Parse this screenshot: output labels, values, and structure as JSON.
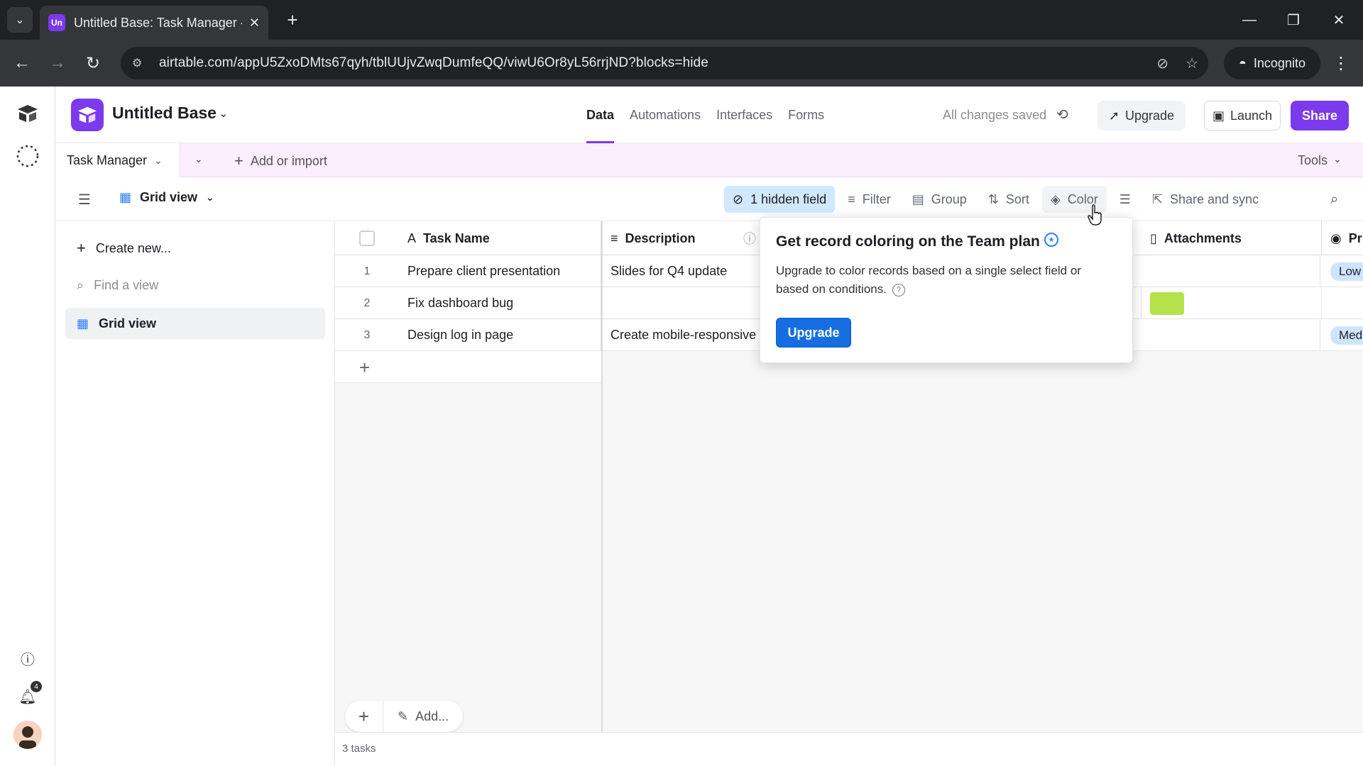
{
  "browser": {
    "tab_title": "Untitled Base: Task Manager - /",
    "tab_favicon_text": "Un",
    "url": "airtable.com/appU5ZxoDMts67qyh/tblUUjvZwqDumfeQQ/viwU6Or8yL56rrjND?blocks=hide",
    "incognito_label": "Incognito"
  },
  "header": {
    "base_name": "Untitled Base",
    "nav": [
      "Data",
      "Automations",
      "Interfaces",
      "Forms"
    ],
    "active_nav": "Data",
    "saved_status": "All changes saved",
    "upgrade_label": "Upgrade",
    "launch_label": "Launch",
    "share_label": "Share",
    "brand_color": "#7c3aed"
  },
  "table_bar": {
    "table_name": "Task Manager",
    "add_import_label": "Add or import",
    "tools_label": "Tools"
  },
  "view_bar": {
    "view_name": "Grid view",
    "hidden_field_label": "1 hidden field",
    "filter_label": "Filter",
    "group_label": "Group",
    "sort_label": "Sort",
    "color_label": "Color",
    "share_sync_label": "Share and sync"
  },
  "sidebar": {
    "create_new_label": "Create new...",
    "find_view_placeholder": "Find a view",
    "views": [
      "Grid view"
    ]
  },
  "grid": {
    "columns": [
      "Task Name",
      "Description",
      "Attachments",
      "Pri"
    ],
    "rows": [
      {
        "num": "1",
        "task": "Prepare client presentation",
        "description": "Slides for Q4 update",
        "priority": "Low"
      },
      {
        "num": "2",
        "task": "Fix dashboard bug",
        "description": "",
        "priority": ""
      },
      {
        "num": "3",
        "task": "Design log in page",
        "description": "Create mobile-responsive",
        "priority": "Med"
      }
    ],
    "add_label": "Add...",
    "record_count": "3 tasks"
  },
  "popover": {
    "title": "Get record coloring on the Team plan",
    "body": "Upgrade to color records based on a single select field or based on conditions.",
    "button_label": "Upgrade"
  },
  "notifications_count": "4"
}
